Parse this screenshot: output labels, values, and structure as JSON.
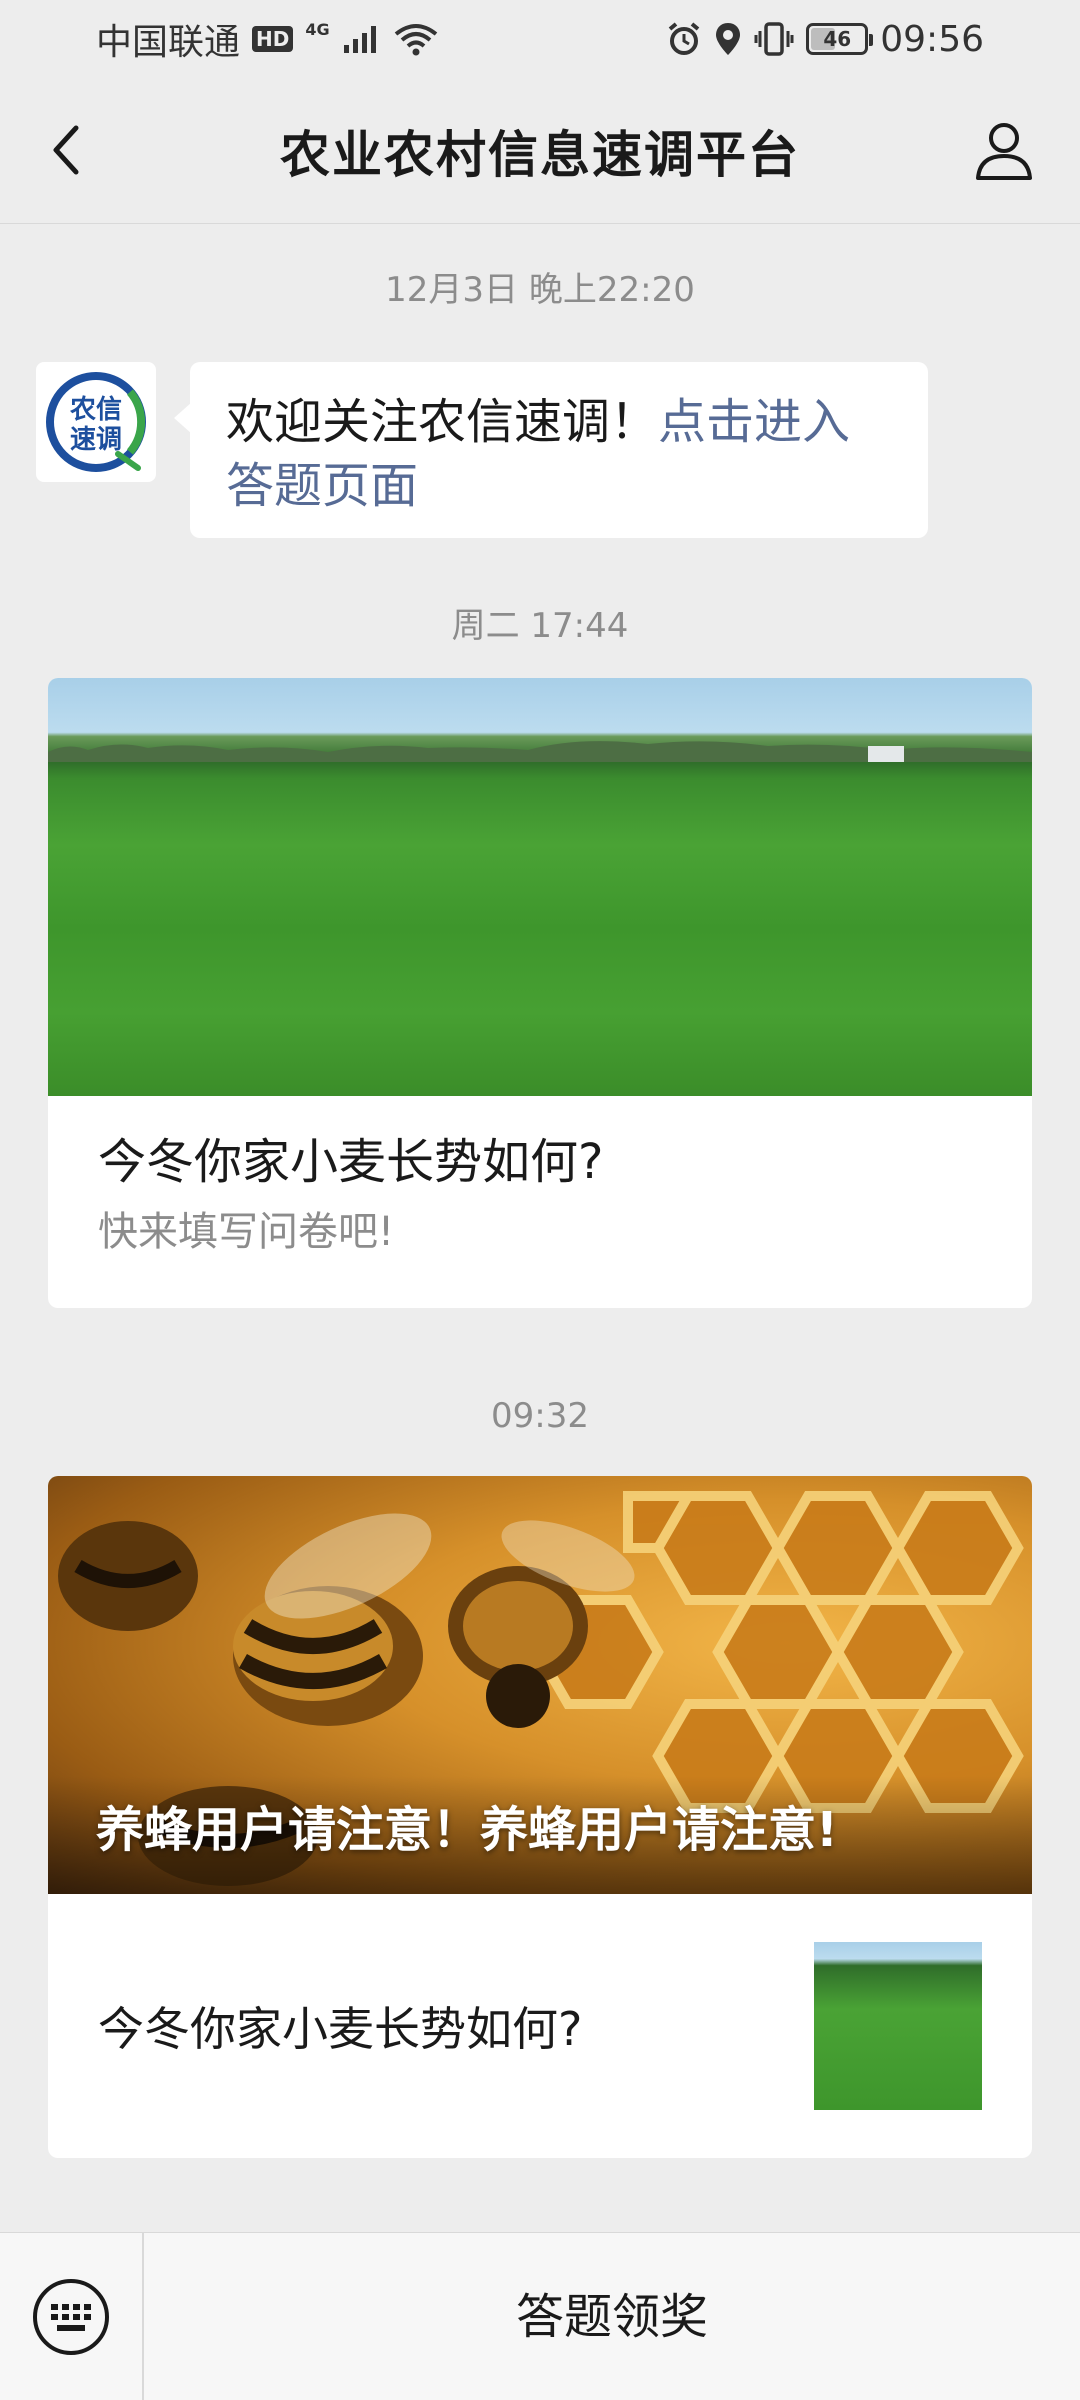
{
  "status_bar": {
    "carrier": "中国联通",
    "hd": "HD",
    "network": "4G",
    "battery": "46",
    "battery_level": 0.46,
    "time": "09:56"
  },
  "nav": {
    "title": "农业农村信息速调平台",
    "back_icon": "chevron-left-icon",
    "profile_icon": "person-icon"
  },
  "chat": {
    "timestamp_1": "12月3日 晚上22:20",
    "welcome_text": "欢迎关注农信速调！",
    "welcome_link": "点击进入答题页面",
    "timestamp_2": "周二 17:44",
    "article_1": {
      "title": "今冬你家小麦长势如何?",
      "subtitle": "快来填写问卷吧!"
    },
    "timestamp_3": "09:32",
    "article_2": {
      "cover_title": "养蜂用户请注意！养蜂用户请注意!",
      "sub_title": "今冬你家小麦长势如何?"
    }
  },
  "avatar": {
    "line1": "农信",
    "line2": "速调"
  },
  "bottom_bar": {
    "keyboard_icon": "keyboard-icon",
    "menu_label": "答题领奖"
  },
  "colors": {
    "link": "#576b95",
    "background": "#ededed",
    "logo_blue": "#1d4f9e",
    "logo_green": "#3aa54a"
  }
}
